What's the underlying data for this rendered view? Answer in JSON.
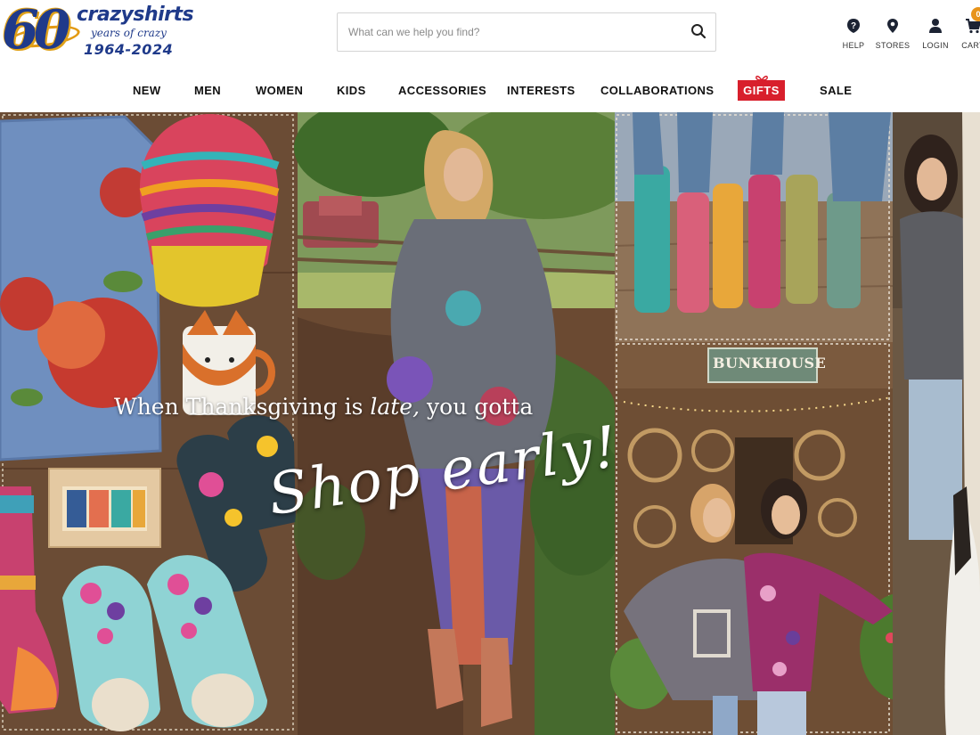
{
  "logo": {
    "number": "60",
    "brand": "crazyshirts",
    "tagline": "years of crazy",
    "years": "1964-2024"
  },
  "search": {
    "placeholder": "What can we help you find?",
    "value": "",
    "icon": "search-icon"
  },
  "utility_nav": [
    {
      "label": "HELP",
      "icon": "help-icon"
    },
    {
      "label": "STORES",
      "icon": "location-pin-icon"
    },
    {
      "label": "LOGIN",
      "icon": "user-icon"
    },
    {
      "label": "CART",
      "icon": "cart-icon"
    }
  ],
  "cart": {
    "count": "0"
  },
  "main_nav": [
    {
      "label": "NEW"
    },
    {
      "label": "MEN"
    },
    {
      "label": "WOMEN"
    },
    {
      "label": "KIDS"
    },
    {
      "label": "ACCESSORIES"
    },
    {
      "label": "INTERESTS"
    },
    {
      "label": "COLLABORATIONS"
    },
    {
      "label": "GIFTS",
      "highlight": "#d81f2c"
    },
    {
      "label": "SALE"
    }
  ],
  "hero": {
    "headline_before": "When Thanksgiving is",
    "headline_emphasis": "late,",
    "headline_after": "you gotta",
    "script_text": "Shop early!",
    "sign_text": "BUNKHOUSE"
  },
  "colors": {
    "brand_blue": "#1f3a8a",
    "brand_gold": "#e39a12",
    "gifts_red": "#d81f2c",
    "cart_badge": "#e8941a"
  }
}
